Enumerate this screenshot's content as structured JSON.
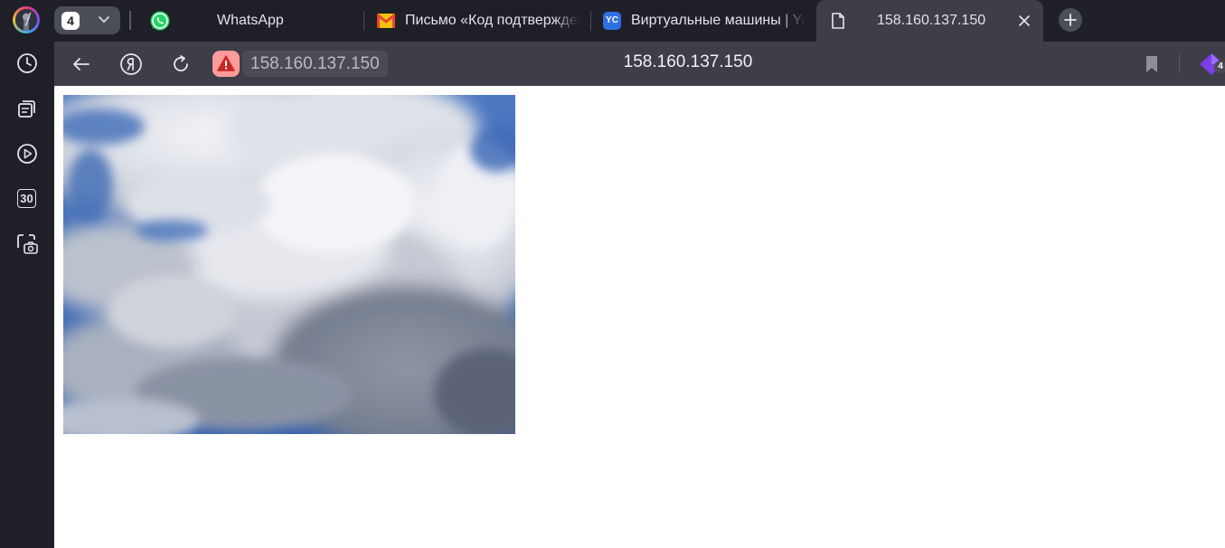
{
  "tabstrip": {
    "tab_group_count": "4",
    "tabs": [
      {
        "title": "WhatsApp",
        "icon": "whatsapp-icon",
        "active": false
      },
      {
        "title": "Письмо «Код подтверждения",
        "icon": "gmail-icon",
        "active": false
      },
      {
        "title": "Виртуальные машины | Yandex",
        "icon": "yandex-cloud-icon",
        "favicon_text": "YC",
        "active": false
      },
      {
        "title": "158.160.137.150",
        "icon": "document-icon",
        "active": true
      }
    ]
  },
  "sidebar": {
    "items": [
      {
        "icon": "history-icon"
      },
      {
        "icon": "collections-icon"
      },
      {
        "icon": "video-play-icon"
      },
      {
        "icon": "calendar-icon",
        "text": "30"
      },
      {
        "icon": "screenshot-camera-icon"
      }
    ]
  },
  "toolbar": {
    "url": "158.160.137.150",
    "page_title": "158.160.137.150",
    "extension_badge": "4"
  },
  "colors": {
    "chrome_dark": "#1f2027",
    "toolbar": "#3d3e47",
    "warning_badge": "#ff9b9b",
    "whatsapp": "#25d366",
    "sky_blue": "#3f6cb5"
  },
  "content": {
    "image_description_alt": ""
  }
}
